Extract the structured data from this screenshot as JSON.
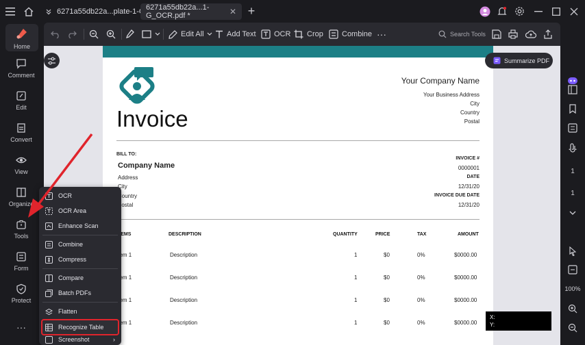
{
  "titlebar": {
    "tabs": [
      {
        "label": "6271a55db22a...plate-1-G.pdf",
        "active": false
      },
      {
        "label": "6271a55db22a...1-G_OCR.pdf *",
        "active": true
      }
    ],
    "tab_close": "✕",
    "new_tab": "+"
  },
  "leftnav": {
    "items": [
      {
        "label": "Home",
        "icon": "home-brand-icon"
      },
      {
        "label": "Comment",
        "icon": "comment-icon"
      },
      {
        "label": "Edit",
        "icon": "edit-icon"
      },
      {
        "label": "Convert",
        "icon": "convert-icon"
      },
      {
        "label": "View",
        "icon": "eye-icon"
      },
      {
        "label": "Organize",
        "icon": "organize-icon"
      },
      {
        "label": "Tools",
        "icon": "toolbox-icon"
      },
      {
        "label": "Form",
        "icon": "form-icon"
      },
      {
        "label": "Protect",
        "icon": "shield-icon"
      }
    ],
    "more": "···"
  },
  "toolbar": {
    "edit_all": "Edit All",
    "add_text": "Add Text",
    "ocr": "OCR",
    "crop": "Crop",
    "combine": "Combine",
    "more": "···",
    "search_tools": "Search Tools"
  },
  "summarize_label": "Summarize PDF",
  "invoice": {
    "title": "Invoice",
    "company_name_top": "Your Company Name",
    "address_lines": [
      "Your Business Address",
      "City",
      "Country",
      "Postal"
    ],
    "bill_to_label": "BILL TO:",
    "bill_company": "Company Name",
    "bill_lines": [
      "Address",
      "City",
      "Country",
      "Postal"
    ],
    "meta": [
      {
        "label": "INVOICE #",
        "value": "0000001"
      },
      {
        "label": "DATE",
        "value": "12/31/20"
      },
      {
        "label": "INVOICE DUE DATE",
        "value": "12/31/20"
      }
    ],
    "columns": [
      "ITEMS",
      "DESCRIPTION",
      "QUANTITY",
      "PRICE",
      "TAX",
      "AMOUNT"
    ],
    "rows": [
      {
        "item": "Item 1",
        "description": "Description",
        "quantity": "1",
        "price": "$0",
        "tax": "0%",
        "amount": "$0000.00"
      },
      {
        "item": "Item 1",
        "description": "Description",
        "quantity": "1",
        "price": "$0",
        "tax": "0%",
        "amount": "$0000.00"
      },
      {
        "item": "Item 1",
        "description": "Description",
        "quantity": "1",
        "price": "$0",
        "tax": "0%",
        "amount": "$0000.00"
      },
      {
        "item": "Item 1",
        "description": "Description",
        "quantity": "1",
        "price": "$0",
        "tax": "0%",
        "amount": "$0000.00"
      }
    ]
  },
  "tools_menu": {
    "items": [
      "OCR",
      "OCR Area",
      "Enhance Scan",
      "Combine",
      "Compress",
      "Compare",
      "Batch PDFs",
      "Flatten",
      "Recognize Table",
      "Screenshot"
    ],
    "highlighted": "Recognize Table"
  },
  "rightnav": {
    "page_current": "1",
    "page_total": "1",
    "zoom": "100%"
  },
  "coords": {
    "x_label": "X:",
    "y_label": "Y:"
  },
  "colors": {
    "accent_teal": "#1c7f86",
    "highlight_red": "#e0242c",
    "annotation_arrow": "#e0242c"
  }
}
